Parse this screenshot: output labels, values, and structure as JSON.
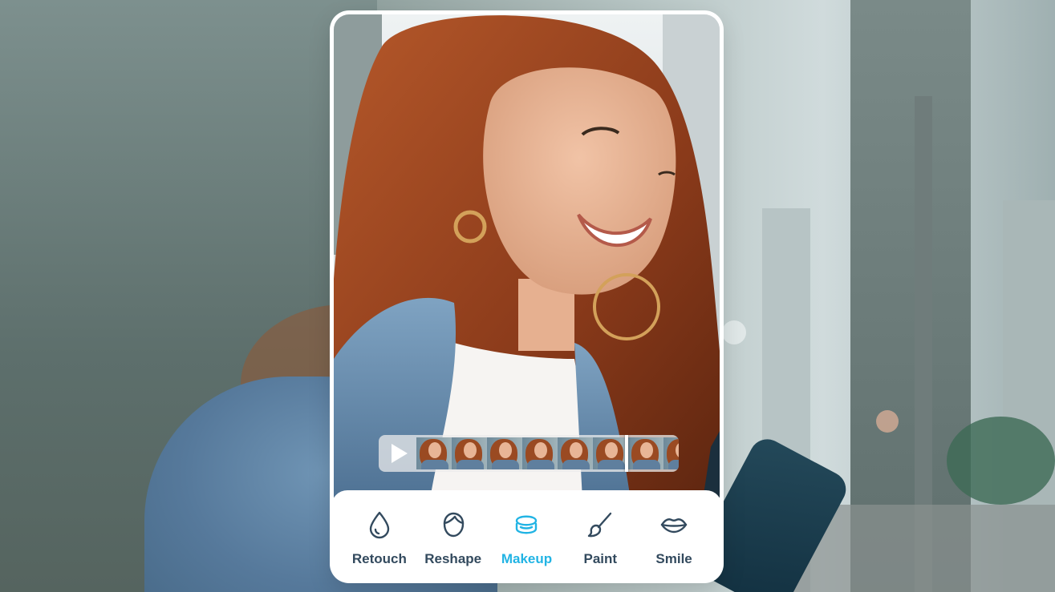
{
  "timeline": {
    "frame_count": 8,
    "playhead_fraction": 0.74
  },
  "toolbar": {
    "accent_color": "#22b4e4",
    "text_color": "#334a5e",
    "active": "Makeup",
    "tools": [
      {
        "label": "Retouch",
        "icon": "droplet-icon"
      },
      {
        "label": "Reshape",
        "icon": "face-outline-icon"
      },
      {
        "label": "Makeup",
        "icon": "compact-powder-icon"
      },
      {
        "label": "Paint",
        "icon": "paintbrush-icon"
      },
      {
        "label": "Smile",
        "icon": "lips-icon"
      }
    ]
  }
}
